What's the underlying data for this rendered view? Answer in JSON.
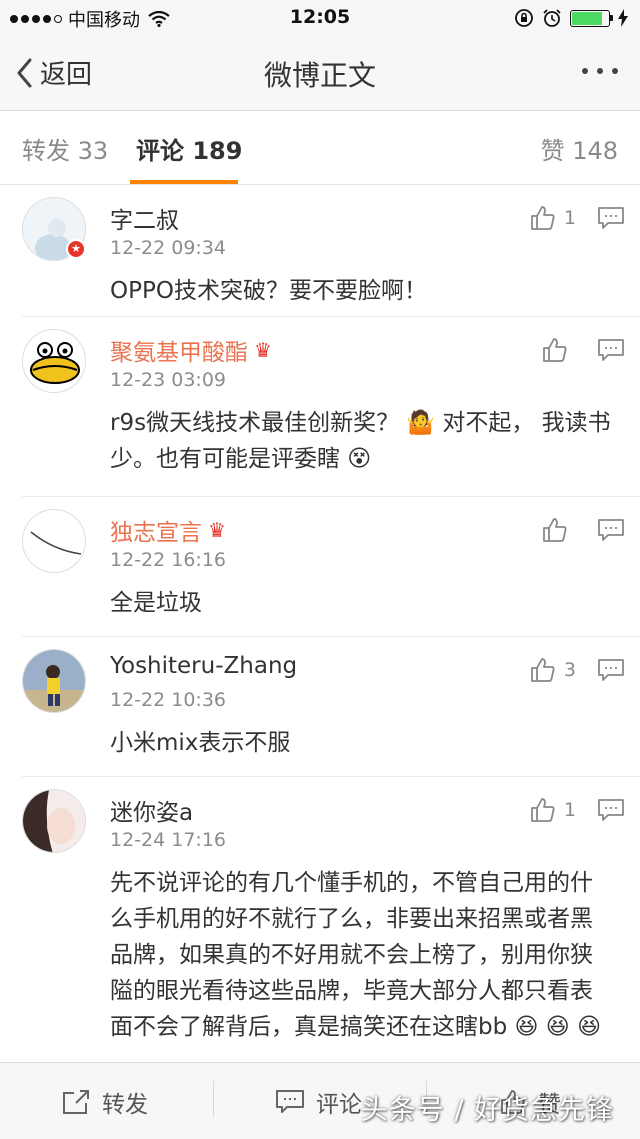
{
  "status_bar": {
    "carrier": "中国移动",
    "time": "12:05"
  },
  "nav": {
    "back_label": "返回",
    "title": "微博正文"
  },
  "tabs": {
    "repost": "转发 33",
    "comments": "评论 189",
    "likes": "赞 148"
  },
  "comments": [
    {
      "name": "字二叔",
      "time": "12-22 09:34",
      "text": "OPPO技术突破？要不要脸啊！",
      "likes": "1"
    },
    {
      "name": "聚氨基甲酸酯",
      "time": "12-23 03:09",
      "text": "r9s微天线技术最佳创新奖？ 🤷 对不起， 我读书少。也有可能是评委瞎 😵",
      "likes": ""
    },
    {
      "name": "独志宣言",
      "time": "12-22 16:16",
      "text": "全是垃圾",
      "likes": ""
    },
    {
      "name": "Yoshiteru-Zhang",
      "time": "12-22 10:36",
      "text": "小米mix表示不服",
      "likes": "3"
    },
    {
      "name": "迷你姿a",
      "time": "12-24 17:16",
      "text": "先不说评论的有几个懂手机的，不管自己用的什么手机用的好不就行了么，非要出来招黑或者黑品牌，如果真的不好用就不会上榜了，别用你狭隘的眼光看待这些品牌，毕竟大部分人都只看表面不会了解背后，真是搞笑还在这瞎bb 😆 😆 😆",
      "likes": "1"
    }
  ],
  "bottom_bar": {
    "repost": "转发",
    "comment": "评论",
    "like": "赞"
  },
  "watermark": "头条号 / 好货急先锋"
}
